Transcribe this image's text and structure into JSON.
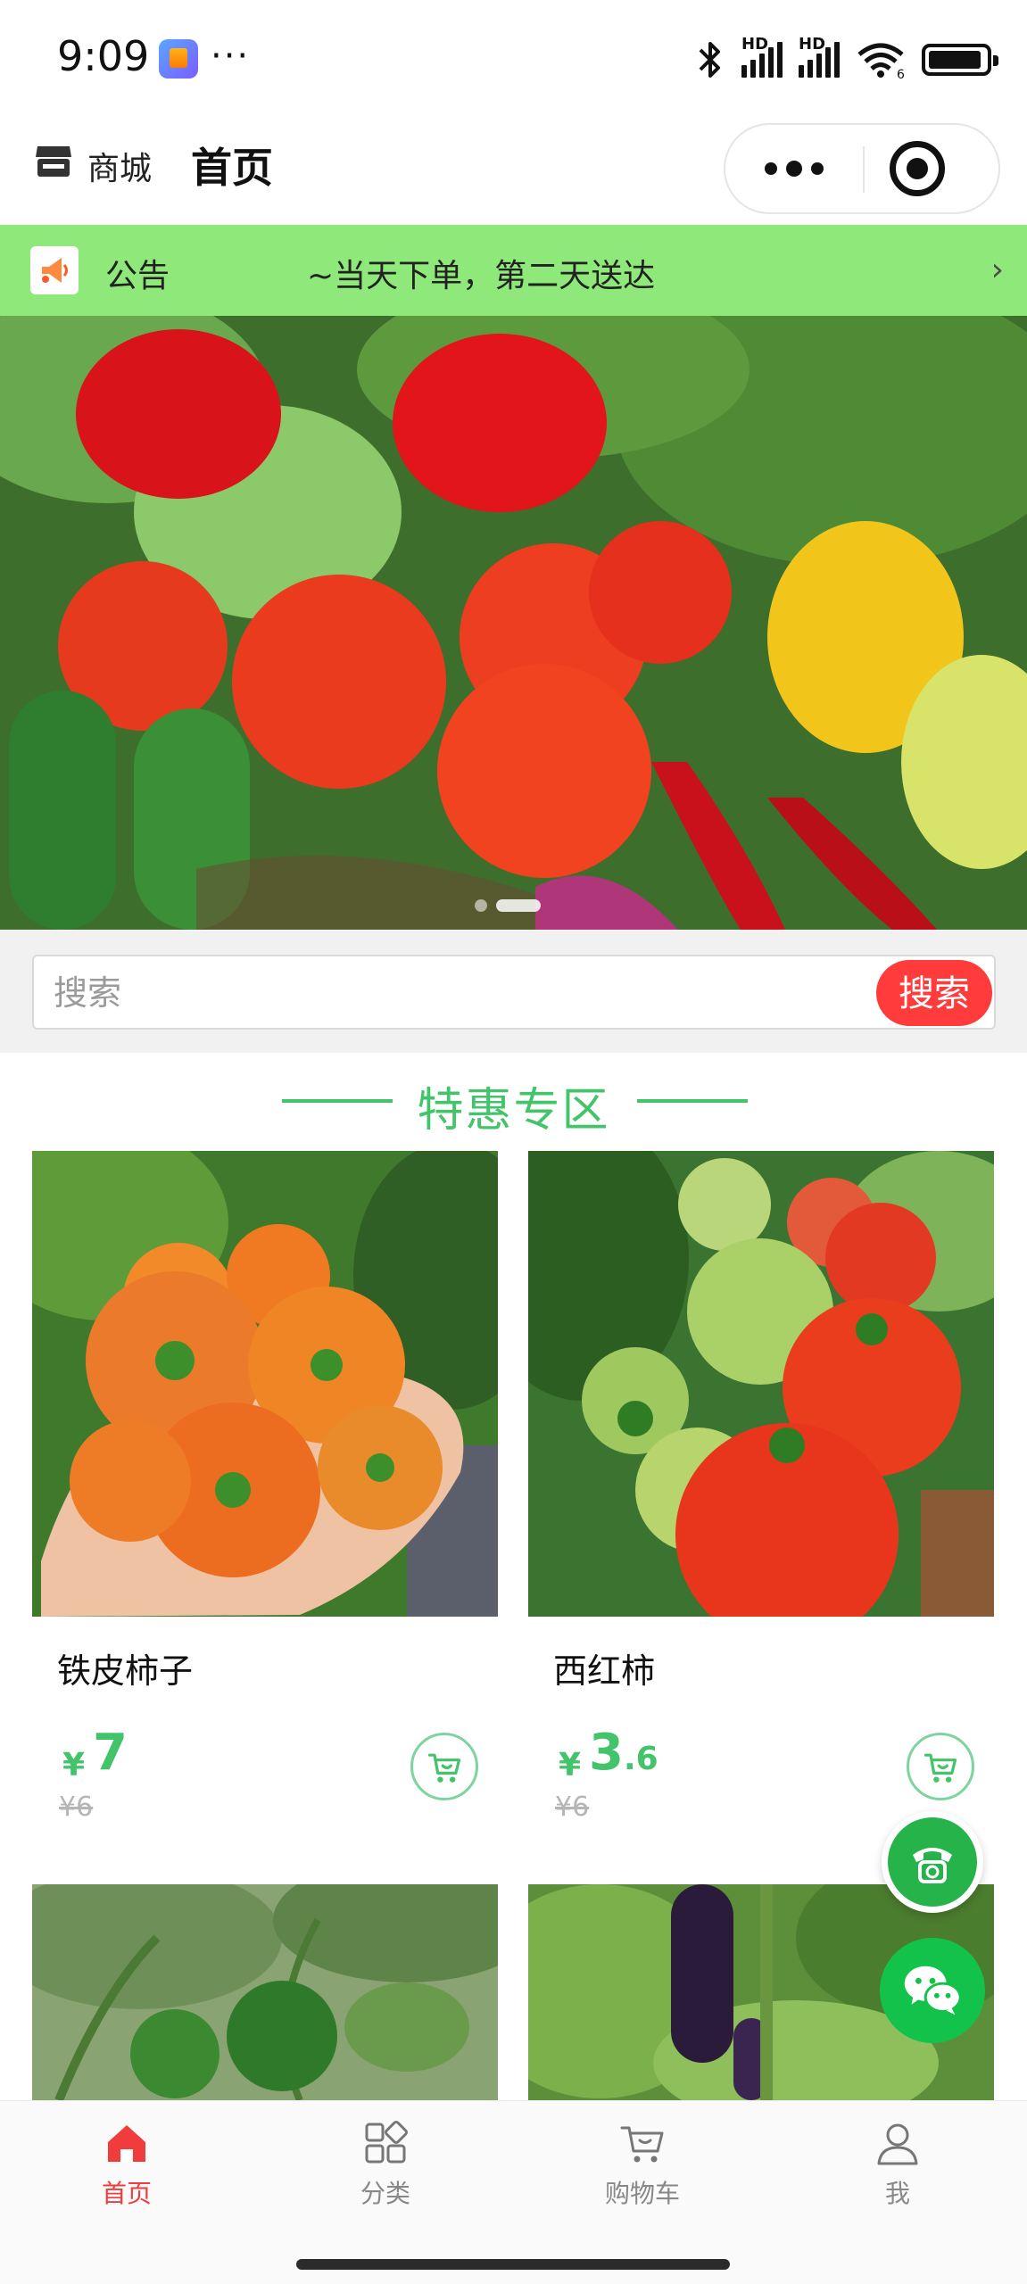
{
  "status_bar": {
    "time": "9:09",
    "dots": "···",
    "hd1": "HD",
    "hd2": "HD",
    "wifi_badge": "6"
  },
  "header": {
    "shop_label": "商城",
    "page_title": "首页"
  },
  "notice": {
    "label": "公告",
    "text": "~当天下单，第二天送达",
    "arrow": "›"
  },
  "search": {
    "placeholder": "搜索",
    "button_label": "搜索"
  },
  "section": {
    "title": "特惠专区"
  },
  "products": [
    {
      "name": "铁皮柿子",
      "currency": "¥",
      "price_int": "7",
      "price_dec": "",
      "old_price": "¥6"
    },
    {
      "name": "西红柿",
      "currency": "¥",
      "price_int": "3",
      "price_dec": ".6",
      "old_price": "¥6"
    },
    {
      "name": "",
      "currency": "",
      "price_int": "",
      "price_dec": "",
      "old_price": ""
    },
    {
      "name": "",
      "currency": "",
      "price_int": "",
      "price_dec": "",
      "old_price": ""
    }
  ],
  "tabbar": {
    "items": [
      {
        "label": "首页",
        "icon": "home-icon",
        "active": true
      },
      {
        "label": "分类",
        "icon": "category-icon",
        "active": false
      },
      {
        "label": "购物车",
        "icon": "cart-icon",
        "active": false
      },
      {
        "label": "我",
        "icon": "user-icon",
        "active": false
      }
    ]
  },
  "colors": {
    "accent_green": "#43c46b",
    "notice_bg": "#8fe87a",
    "search_button": "#ff3b3b",
    "tab_active": "#f03c3c"
  }
}
